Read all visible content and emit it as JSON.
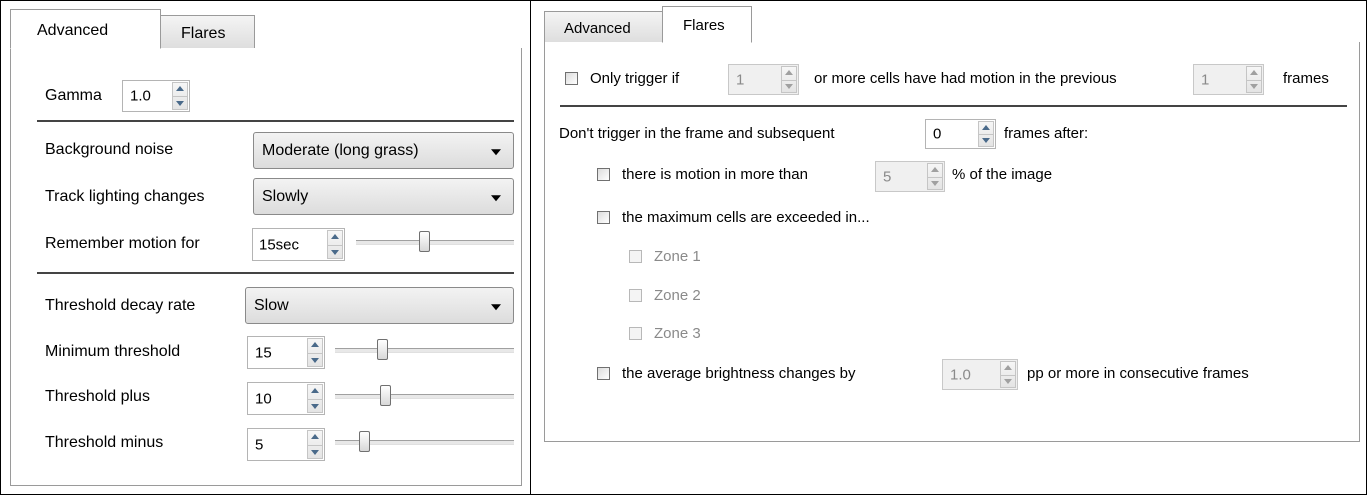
{
  "left_panel": {
    "tabs": [
      {
        "label": "Advanced",
        "active": true
      },
      {
        "label": "Flares",
        "active": false
      }
    ],
    "gamma": {
      "label": "Gamma",
      "value": "1.0"
    },
    "background_noise": {
      "label": "Background noise",
      "value": "Moderate (long grass)"
    },
    "track_lighting": {
      "label": "Track lighting changes",
      "value": "Slowly"
    },
    "remember_motion": {
      "label": "Remember motion for",
      "value": "15sec",
      "slider_fraction": 0.43
    },
    "threshold_decay": {
      "label": "Threshold decay rate",
      "value": "Slow"
    },
    "minimum_threshold": {
      "label": "Minimum threshold",
      "value": "15",
      "slider_fraction": 0.25
    },
    "threshold_plus": {
      "label": "Threshold plus",
      "value": "10",
      "slider_fraction": 0.27
    },
    "threshold_minus": {
      "label": "Threshold minus",
      "value": "5",
      "slider_fraction": 0.14
    }
  },
  "right_panel": {
    "tabs": [
      {
        "label": "Advanced",
        "active": false
      },
      {
        "label": "Flares",
        "active": true
      }
    ],
    "only_trigger": {
      "checked": false,
      "label_pre": "Only trigger if",
      "cells_value": "1",
      "label_mid": "or more cells have had motion in the previous",
      "frames_value": "1",
      "label_post": "frames"
    },
    "dont_trigger": {
      "label_pre": "Don't trigger in the frame and subsequent",
      "value": "0",
      "label_post": "frames after:"
    },
    "motion_more_than": {
      "checked": false,
      "label_pre": "there is motion in more than",
      "value": "5",
      "label_post": "% of the image"
    },
    "max_cells": {
      "checked": false,
      "label": "the maximum cells are exceeded in..."
    },
    "zones": [
      {
        "label": "Zone 1",
        "checked": false
      },
      {
        "label": "Zone 2",
        "checked": false
      },
      {
        "label": "Zone 3",
        "checked": false
      }
    ],
    "brightness": {
      "checked": false,
      "label_pre": "the average brightness changes by",
      "value": "1.0",
      "label_post": "pp or more in consecutive frames"
    }
  }
}
